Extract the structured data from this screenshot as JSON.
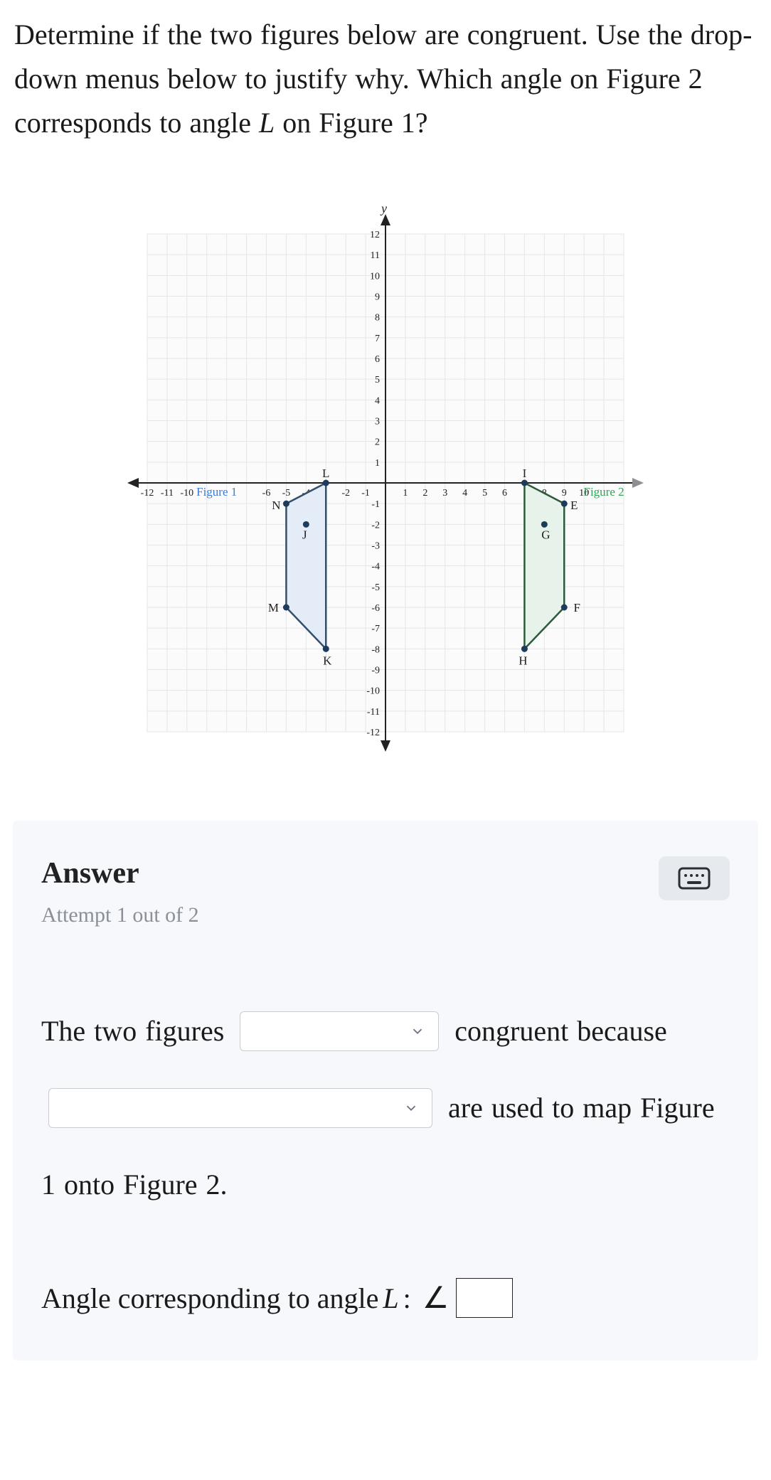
{
  "question": {
    "line1_pre": "Determine if the two figures below are congruent. Use the drop-down menus below to justify why. Which angle on Figure 2 corresponds to angle ",
    "var": "L",
    "line1_post": " on Figure 1?"
  },
  "graph": {
    "axis_y_label": "y",
    "y_ticks": [
      12,
      11,
      10,
      9,
      8,
      7,
      6,
      5,
      4,
      3,
      2,
      1,
      -1,
      -2,
      -3,
      -4,
      -5,
      -6,
      -7,
      -8,
      -9,
      -10,
      -11,
      -12
    ],
    "x_ticks_neg": [
      -12,
      -11,
      -10,
      -6,
      -5,
      -4,
      -2,
      -1
    ],
    "x_ticks_pos": [
      1,
      2,
      3,
      4,
      5,
      6,
      8,
      9,
      10
    ],
    "fig1_label": "Figure 1",
    "fig2_label": "Figure 2",
    "fig1_vertices": {
      "L": "L",
      "N": "N",
      "J": "J",
      "M": "M",
      "K": "K"
    },
    "fig2_vertices": {
      "I": "I",
      "E": "E",
      "G": "G",
      "F": "F",
      "H": "H"
    }
  },
  "answer": {
    "title": "Answer",
    "attempt": "Attempt 1 out of 2",
    "sentence": {
      "p1": "The two figures",
      "p2": "congruent",
      "p3": "because",
      "p4": "are used",
      "p5": "to map Figure 1 onto Figure 2."
    },
    "corresponding": {
      "label_pre": "Angle corresponding to angle ",
      "var": "L",
      "label_post": ": "
    }
  },
  "chart_data": {
    "type": "scatter",
    "title": "",
    "xlabel": "",
    "ylabel": "y",
    "xlim": [
      -12,
      12
    ],
    "ylim": [
      -12,
      12
    ],
    "series": [
      {
        "name": "Figure 1",
        "color": "#d9e4f5",
        "points": [
          {
            "label": "L",
            "x": -3,
            "y": 0
          },
          {
            "label": "N",
            "x": -5,
            "y": -1
          },
          {
            "label": "J",
            "x": -4,
            "y": -2
          },
          {
            "label": "M",
            "x": -5,
            "y": -6
          },
          {
            "label": "K",
            "x": -3,
            "y": -8
          }
        ]
      },
      {
        "name": "Figure 2",
        "color": "#e0f0e4",
        "points": [
          {
            "label": "I",
            "x": 7,
            "y": 0
          },
          {
            "label": "E",
            "x": 9,
            "y": -1
          },
          {
            "label": "G",
            "x": 8,
            "y": -2
          },
          {
            "label": "F",
            "x": 9,
            "y": -6
          },
          {
            "label": "H",
            "x": 7,
            "y": -8
          }
        ]
      }
    ]
  }
}
